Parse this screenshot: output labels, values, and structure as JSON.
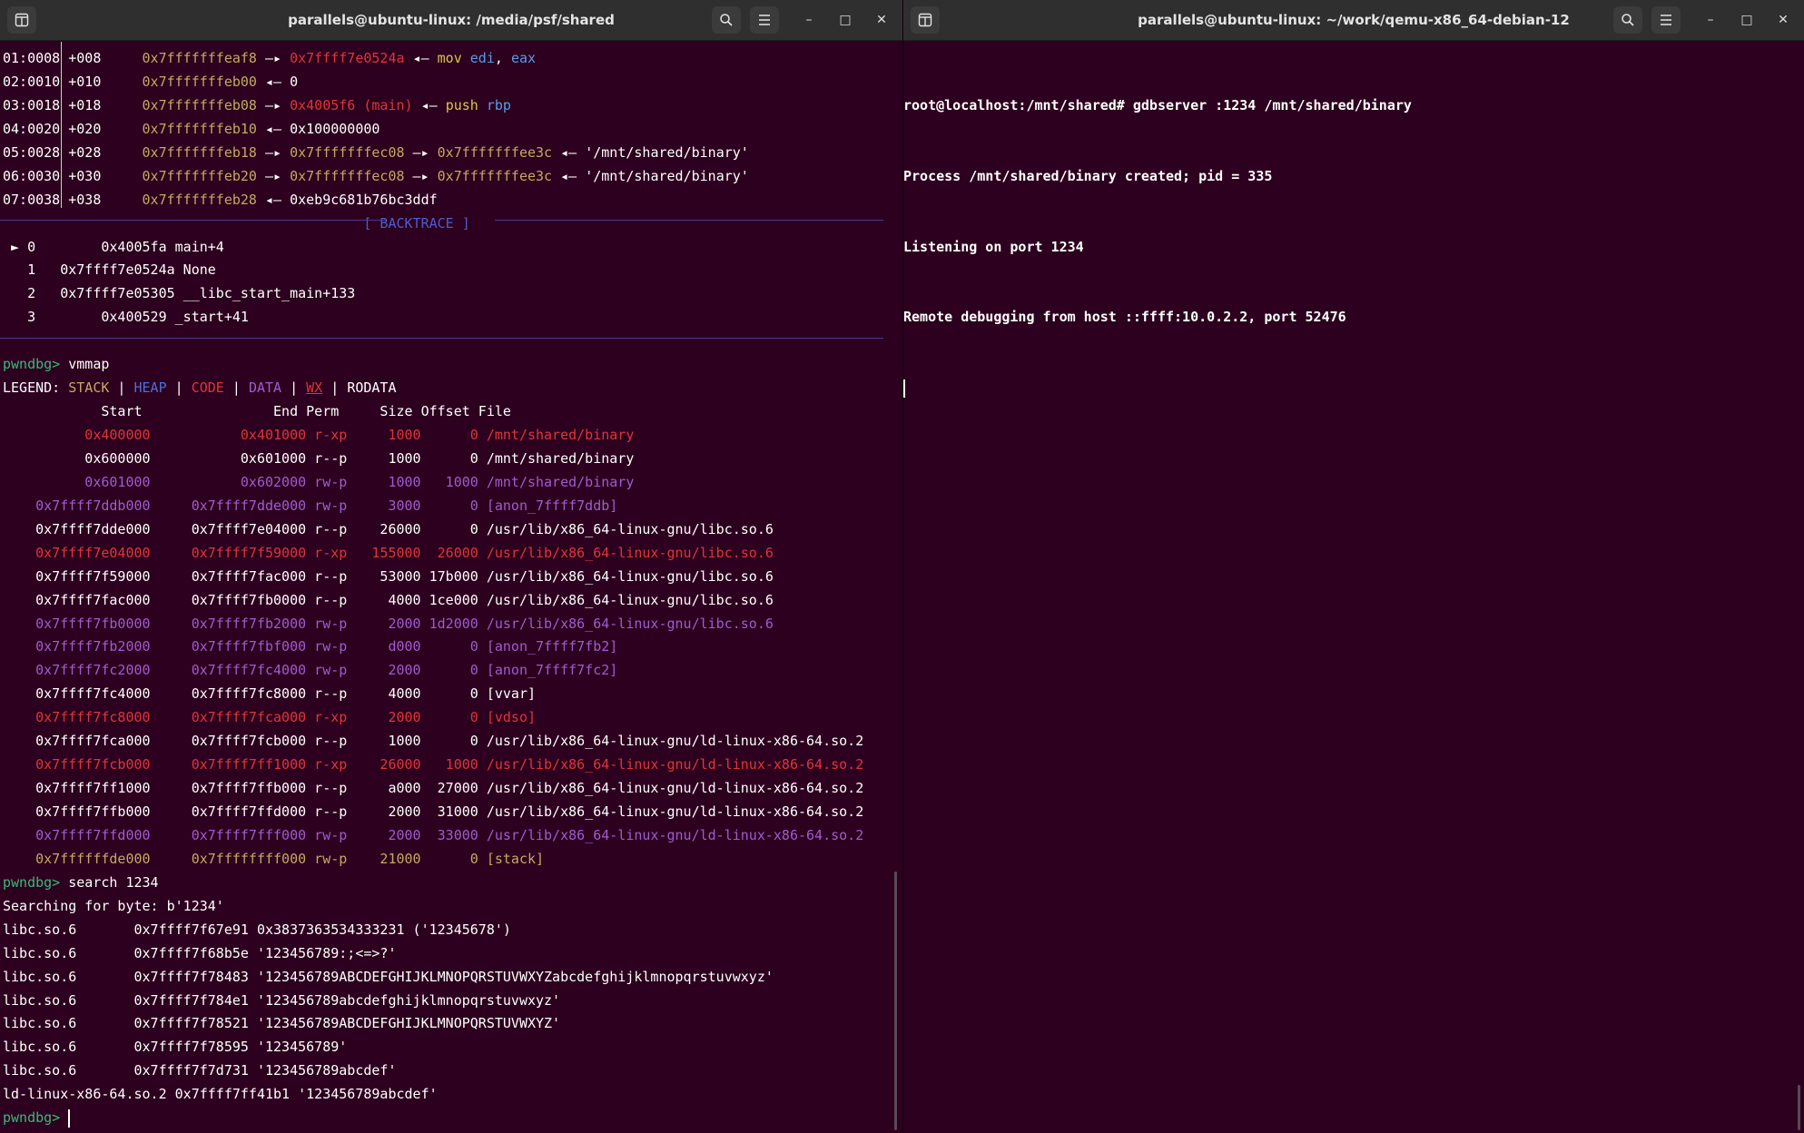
{
  "left_window": {
    "title": "parallels@ubuntu-linux: /media/psf/shared",
    "stack_rows": [
      {
        "idx": "01:0008",
        "off": "+008",
        "addr": "0x7fffffffeaf8",
        "rest": [
          [
            "c-red",
            "0x7ffff7e0524a"
          ],
          [
            "c-wht",
            " ◂— "
          ],
          [
            "c-mov",
            "mov"
          ],
          [
            "c-wht",
            " "
          ],
          [
            "c-reg",
            "edi"
          ],
          [
            "c-wht",
            ", "
          ],
          [
            "c-reg",
            "eax"
          ]
        ]
      },
      {
        "idx": "02:0010",
        "off": "+010",
        "addr": "0x7fffffffeb00",
        "rest": [
          [
            "c-wht",
            "0"
          ]
        ]
      },
      {
        "idx": "03:0018",
        "off": "+018",
        "addr": "0x7fffffffeb08",
        "rest": [
          [
            "c-red",
            "0x4005f6 (main)"
          ],
          [
            "c-wht",
            " ◂— "
          ],
          [
            "c-mov",
            "push"
          ],
          [
            "c-wht",
            " "
          ],
          [
            "c-reg",
            "rbp"
          ]
        ]
      },
      {
        "idx": "04:0020",
        "off": "+020",
        "addr": "0x7fffffffeb10",
        "rest": [
          [
            "c-wht",
            "0x100000000"
          ]
        ]
      },
      {
        "idx": "05:0028",
        "off": "+028",
        "addr": "0x7fffffffeb18",
        "rest": [
          [
            "c-yel",
            "0x7fffffffec08"
          ],
          [
            "c-wht",
            " —▸ "
          ],
          [
            "c-yel",
            "0x7fffffffee3c"
          ],
          [
            "c-wht",
            " ◂— '/mnt/shared/binary'"
          ]
        ]
      },
      {
        "idx": "06:0030",
        "off": "+030",
        "addr": "0x7fffffffeb20",
        "rest": [
          [
            "c-yel",
            "0x7fffffffec08"
          ],
          [
            "c-wht",
            " —▸ "
          ],
          [
            "c-yel",
            "0x7fffffffee3c"
          ],
          [
            "c-wht",
            " ◂— '/mnt/shared/binary'"
          ]
        ]
      },
      {
        "idx": "07:0038",
        "off": "+038",
        "addr": "0x7fffffffeb28",
        "rest": [
          [
            "c-wht",
            "0xeb9c681b76bc3ddf"
          ]
        ]
      }
    ],
    "backtrace_label": "[ BACKTRACE ]",
    "backtrace": [
      {
        "marker": "►",
        "n": "0",
        "addr": "0x4005fa",
        "sym": "main+4",
        "indent": true
      },
      {
        "marker": " ",
        "n": "1",
        "addr": "0x7ffff7e0524a",
        "sym": "None",
        "indent": false
      },
      {
        "marker": " ",
        "n": "2",
        "addr": "0x7ffff7e05305",
        "sym": "__libc_start_main+133",
        "indent": false
      },
      {
        "marker": " ",
        "n": "3",
        "addr": "0x400529",
        "sym": "_start+41",
        "indent": true
      }
    ],
    "prompt": "pwndbg>",
    "cmd_vmmap": "vmmap",
    "legend_label": "LEGEND:",
    "legend": [
      [
        "c-yel",
        "STACK"
      ],
      [
        "c-blu",
        "HEAP"
      ],
      [
        "c-red",
        "CODE"
      ],
      [
        "c-pur",
        "DATA"
      ],
      [
        "c-red ul",
        "WX"
      ],
      [
        "c-wht",
        "RODATA"
      ]
    ],
    "vmmap_header": "            Start                End Perm     Size Offset File",
    "vmmap_rows": [
      [
        "c-red",
        "          0x400000           0x401000 r-xp     1000      0 /mnt/shared/binary"
      ],
      [
        "c-wht",
        "          0x600000           0x601000 r--p     1000      0 /mnt/shared/binary"
      ],
      [
        "c-pur",
        "          0x601000           0x602000 rw-p     1000   1000 /mnt/shared/binary"
      ],
      [
        "c-pur",
        "    0x7ffff7ddb000     0x7ffff7dde000 rw-p     3000      0 [anon_7ffff7ddb]"
      ],
      [
        "c-wht",
        "    0x7ffff7dde000     0x7ffff7e04000 r--p    26000      0 /usr/lib/x86_64-linux-gnu/libc.so.6"
      ],
      [
        "c-red",
        "    0x7ffff7e04000     0x7ffff7f59000 r-xp   155000  26000 /usr/lib/x86_64-linux-gnu/libc.so.6"
      ],
      [
        "c-wht",
        "    0x7ffff7f59000     0x7ffff7fac000 r--p    53000 17b000 /usr/lib/x86_64-linux-gnu/libc.so.6"
      ],
      [
        "c-wht",
        "    0x7ffff7fac000     0x7ffff7fb0000 r--p     4000 1ce000 /usr/lib/x86_64-linux-gnu/libc.so.6"
      ],
      [
        "c-pur",
        "    0x7ffff7fb0000     0x7ffff7fb2000 rw-p     2000 1d2000 /usr/lib/x86_64-linux-gnu/libc.so.6"
      ],
      [
        "c-pur",
        "    0x7ffff7fb2000     0x7ffff7fbf000 rw-p     d000      0 [anon_7ffff7fb2]"
      ],
      [
        "c-pur",
        "    0x7ffff7fc2000     0x7ffff7fc4000 rw-p     2000      0 [anon_7ffff7fc2]"
      ],
      [
        "c-wht",
        "    0x7ffff7fc4000     0x7ffff7fc8000 r--p     4000      0 [vvar]"
      ],
      [
        "c-red",
        "    0x7ffff7fc8000     0x7ffff7fca000 r-xp     2000      0 [vdso]"
      ],
      [
        "c-wht",
        "    0x7ffff7fca000     0x7ffff7fcb000 r--p     1000      0 /usr/lib/x86_64-linux-gnu/ld-linux-x86-64.so.2"
      ],
      [
        "c-red",
        "    0x7ffff7fcb000     0x7ffff7ff1000 r-xp    26000   1000 /usr/lib/x86_64-linux-gnu/ld-linux-x86-64.so.2"
      ],
      [
        "c-wht",
        "    0x7ffff7ff1000     0x7ffff7ffb000 r--p     a000  27000 /usr/lib/x86_64-linux-gnu/ld-linux-x86-64.so.2"
      ],
      [
        "c-wht",
        "    0x7ffff7ffb000     0x7ffff7ffd000 r--p     2000  31000 /usr/lib/x86_64-linux-gnu/ld-linux-x86-64.so.2"
      ],
      [
        "c-pur",
        "    0x7ffff7ffd000     0x7ffff7fff000 rw-p     2000  33000 /usr/lib/x86_64-linux-gnu/ld-linux-x86-64.so.2"
      ],
      [
        "c-yel",
        "    0x7ffffffde000     0x7ffffffff000 rw-p    21000      0 [stack]"
      ]
    ],
    "cmd_search": "search 1234",
    "search_lines": [
      "Searching for byte: b'1234'",
      "libc.so.6       0x7ffff7f67e91 0x3837363534333231 ('12345678')",
      "libc.so.6       0x7ffff7f68b5e '123456789:;<=>?'",
      "libc.so.6       0x7ffff7f78483 '123456789ABCDEFGHIJKLMNOPQRSTUVWXYZabcdefghijklmnopqrstuvwxyz'",
      "libc.so.6       0x7ffff7f784e1 '123456789abcdefghijklmnopqrstuvwxyz'",
      "libc.so.6       0x7ffff7f78521 '123456789ABCDEFGHIJKLMNOPQRSTUVWXYZ'",
      "libc.so.6       0x7ffff7f78595 '123456789'",
      "libc.so.6       0x7ffff7f7d731 '123456789abcdef'",
      "ld-linux-x86-64.so.2 0x7ffff7ff41b1 '123456789abcdef'"
    ]
  },
  "right_window": {
    "title": "parallels@ubuntu-linux: ~/work/qemu-x86_64-debian-12",
    "lines": [
      "root@localhost:/mnt/shared# gdbserver :1234 /mnt/shared/binary",
      "Process /mnt/shared/binary created; pid = 335",
      "Listening on port 1234",
      "Remote debugging from host ::ffff:10.0.2.2, port 52476"
    ]
  },
  "controls": {
    "minimize": "–",
    "maximize": "□",
    "close": "✕"
  },
  "icons": {
    "new_tab": "new-tab-icon",
    "search": "search-icon",
    "menu": "hamburger-menu-icon"
  }
}
